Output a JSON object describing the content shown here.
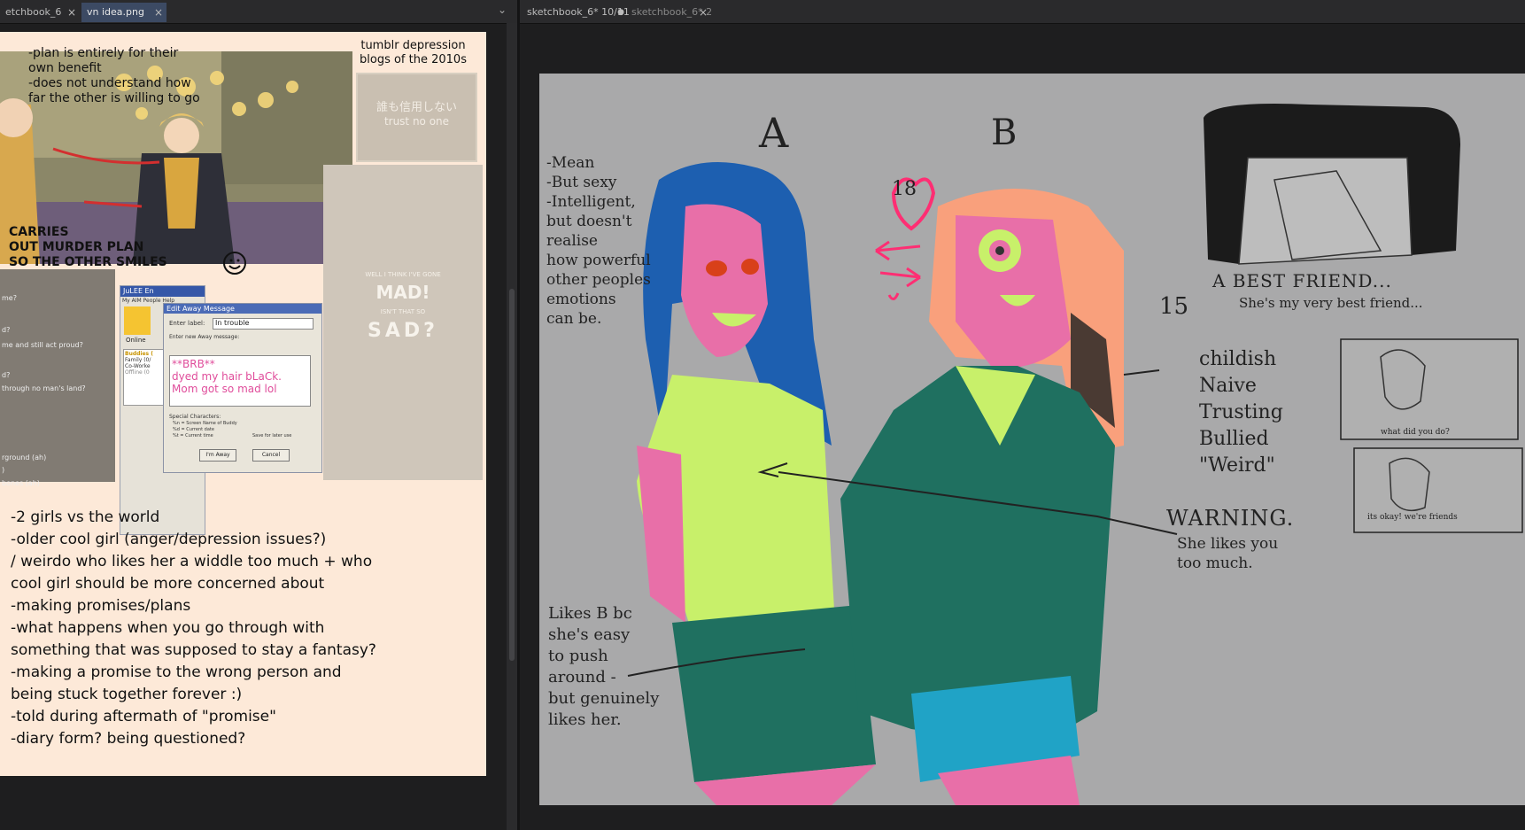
{
  "left_tabs": [
    {
      "label": "etchbook_6",
      "active": false
    },
    {
      "label": "vn idea.png",
      "active": true
    }
  ],
  "right_tabs": [
    {
      "label": "sketchbook_6* 10/11",
      "active": true
    },
    {
      "label": "sketchbook_6* 2/11",
      "active": false
    }
  ],
  "close_glyph": "×",
  "dot_glyph": "●",
  "chevron_glyph": "⌄",
  "left": {
    "plan_note": "-plan is entirely for their\nown benefit\n-does not understand how\nfar the other is willing to go",
    "tumblr_label": "tumblr depression\nblogs of the 2010s",
    "tumblr_jp": "誰も信用しない",
    "tumblr_en": "trust no one",
    "mad_top": "WELL I THINK I'VE GONE",
    "mad_word": "MAD!",
    "mad_mid": "ISN'T THAT SO",
    "sad_word": "SAD?",
    "carries_note": "CARRIES\nOUT MURDER PLAN\nSO THE OTHER SMILES",
    "side_lines": [
      "me?",
      "d?",
      "me and still act proud?",
      "d?",
      "through no man's land?",
      "rground (ah)",
      ")",
      "bones (ah)"
    ],
    "aim": {
      "title": "JuLEE En",
      "menu": "My AIM  People  Help",
      "dialog_title": "Edit Away Message",
      "enter_label": "Enter label:",
      "label_value": "In trouble",
      "enter_msg": "Enter new Away message:",
      "message": "**BRB**\ndyed my hair bLaCk.\nMom got so mad lol",
      "special_title": "Special Characters:",
      "special_lines": [
        "%n  = Screen Name of Buddy",
        "%d  = Current date",
        "%t  = Current time"
      ],
      "save_label": "Save for later use",
      "away_btn": "I'm Away",
      "cancel_btn": "Cancel",
      "online_label": "Online",
      "buddies": [
        "Buddies (",
        "Family (0/",
        "Co-Worke",
        "Offline (0"
      ]
    },
    "bullets": [
      "-2 girls vs the world",
      "-older cool girl (anger/depression issues?)",
      "/ weirdo who likes her a widdle too much + who",
      "cool girl should be more concerned about",
      "-making promises/plans",
      "-what happens when you go through with",
      "something that was supposed to stay a fantasy?",
      "-making a promise to the wrong person and",
      "being stuck together forever :)",
      "-told during aftermath of \"promise\"",
      "-diary form? being questioned?"
    ]
  },
  "right": {
    "label_a": "A",
    "label_b": "B",
    "age_a": "18",
    "age_b": "15",
    "a_traits": "-Mean\n-But sexy\n-Intelligent,\nbut doesn't\nrealise\nhow powerful\nother peoples\nemotions\ncan be.",
    "best_friend": "A  BEST FRIEND...",
    "best_friend_sub": "She's my very best friend...",
    "b_traits": "childish\nNaive\nTrusting\nBullied\n\"Weird\"",
    "warning": "WARNING.",
    "warning_sub": "She likes you\ntoo much.",
    "likes_b": "Likes B bc\nshe's easy\nto push\naround -\nbut genuinely\nlikes her.",
    "panel1_caption": "what did you do?",
    "panel2_caption": "its okay! we're friends",
    "colors": {
      "hair_a": "#1d5fb0",
      "skin": "#e86fa8",
      "hair_b": "#f9a07c",
      "shirt": "#c8f06a",
      "sweater": "#1f7060",
      "skirt_b": "#20a3c6",
      "heart": "#ff2e73"
    }
  }
}
